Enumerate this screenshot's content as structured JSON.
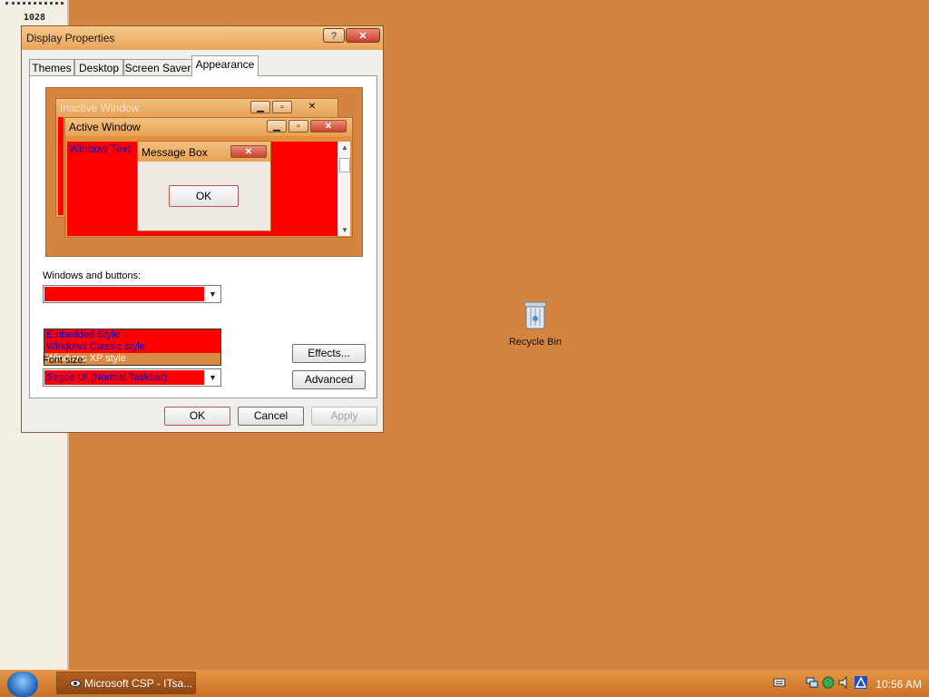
{
  "left_strip": {
    "number": "1028"
  },
  "dialog": {
    "title": "Display Properties",
    "help_label": "?",
    "tabs": [
      {
        "label": "Themes"
      },
      {
        "label": "Desktop"
      },
      {
        "label": "Screen Saver"
      },
      {
        "label": "Appearance"
      }
    ],
    "active_tab": "Appearance",
    "preview": {
      "inactive_title": "Inactive Window",
      "active_title": "Active Window",
      "window_text": "Window Text",
      "message_box_title": "Message Box",
      "message_box_ok": "OK"
    },
    "windows_buttons_label": "Windows and buttons:",
    "windows_buttons_options": [
      "Embedded Style",
      "Windows Classic style",
      "Windows XP style"
    ],
    "windows_buttons_highlighted": "Windows XP style",
    "font_size_label": "Font size:",
    "font_size_value": "Segoe UI (Normal Taskbar)",
    "effects_label": "Effects...",
    "advanced_label": "Advanced",
    "ok_label": "OK",
    "cancel_label": "Cancel",
    "apply_label": "Apply"
  },
  "desktop": {
    "recycle_bin_label": "Recycle Bin"
  },
  "taskbar": {
    "task_item": "Microsoft CSP - ITsa...",
    "clock": "10:56 AM"
  },
  "colors": {
    "desktop": "#d4843e",
    "preview_red": "#ff0000",
    "preview_text_blue": "#0000cc"
  }
}
